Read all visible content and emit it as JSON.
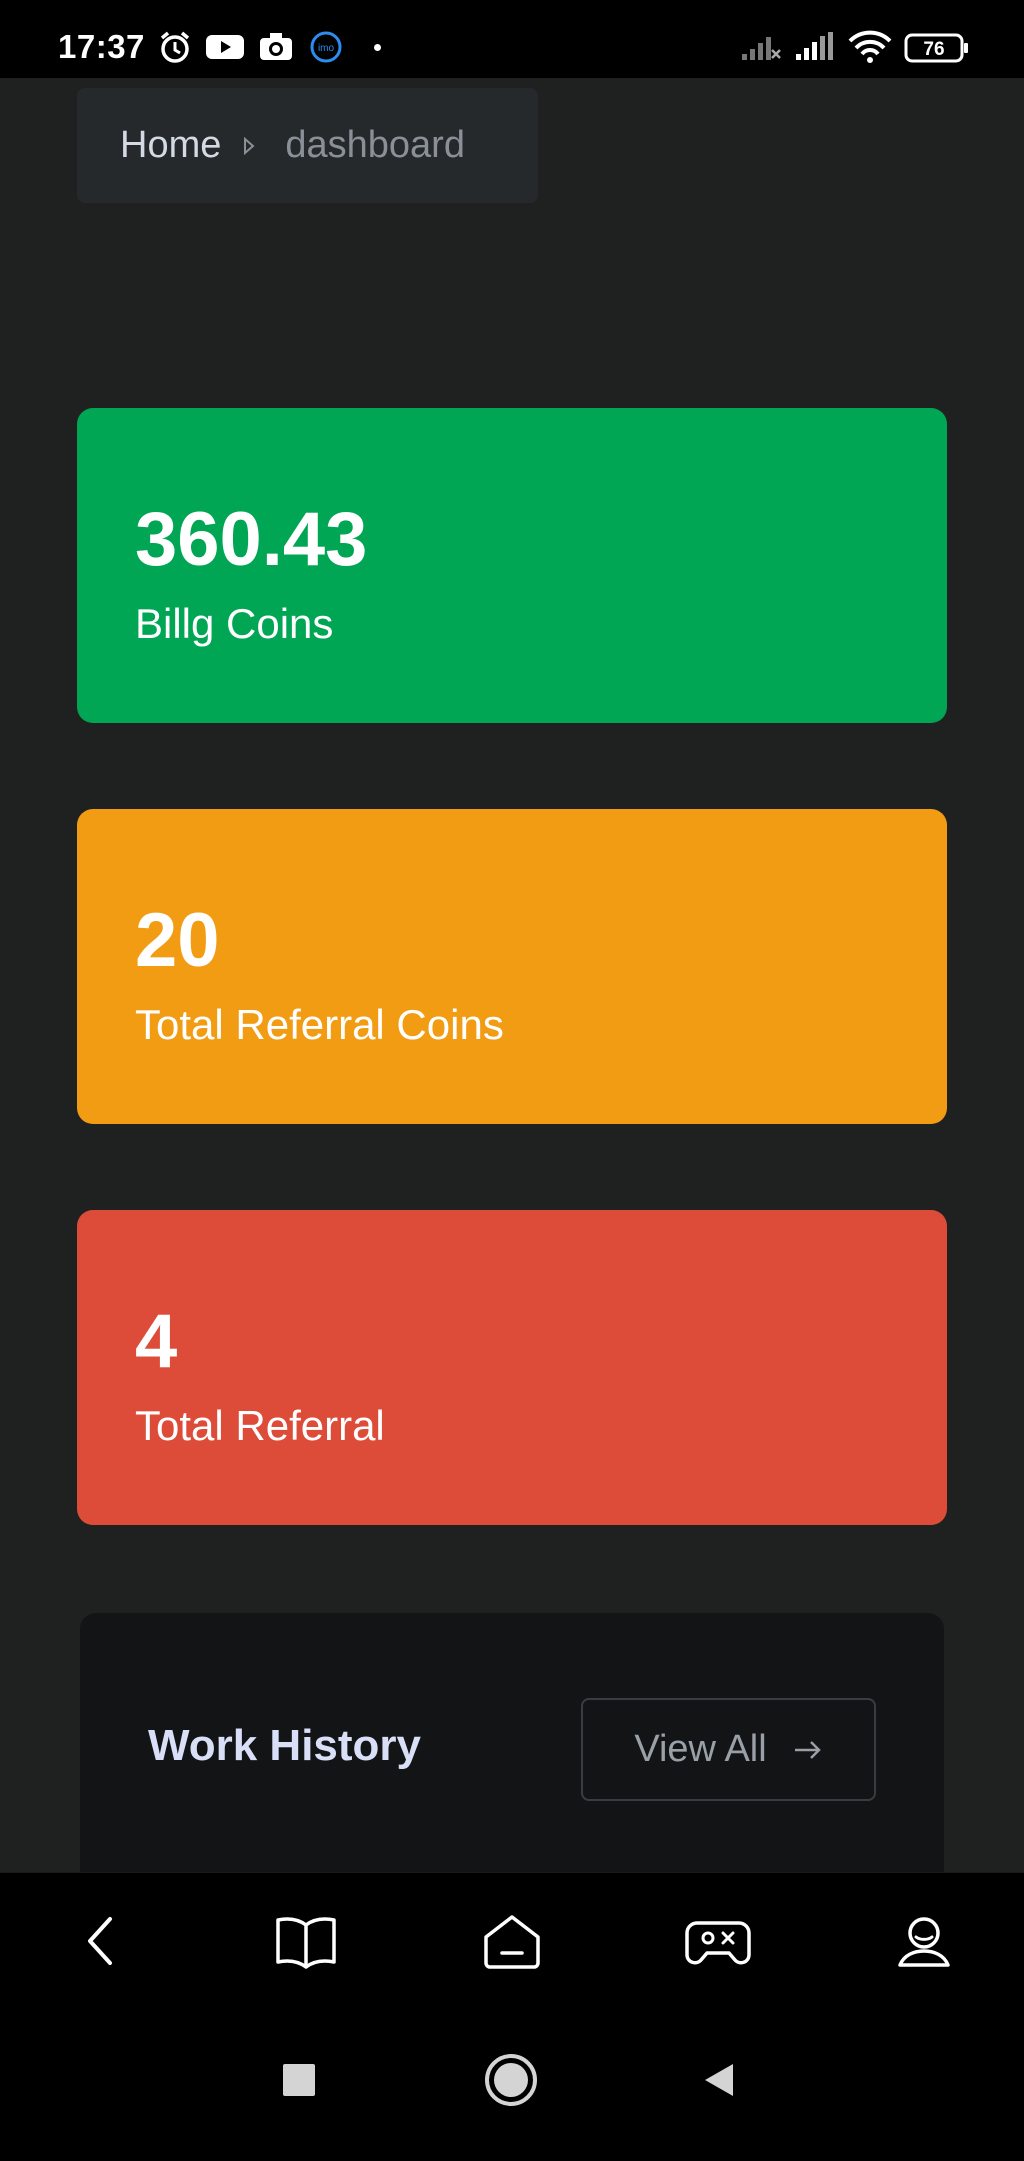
{
  "status_bar": {
    "time": "17:37",
    "battery": "76",
    "icons": [
      "alarm-icon",
      "youtube-icon",
      "camera-icon",
      "imo-icon",
      "signal-x-icon",
      "signal-icon",
      "wifi-icon",
      "battery-icon"
    ]
  },
  "breadcrumb": {
    "home": "Home",
    "current": "dashboard"
  },
  "stats": [
    {
      "value": "360.43",
      "label": "Billg Coins",
      "color": "#00a653"
    },
    {
      "value": "20",
      "label": "Total Referral Coins",
      "color": "#f29c14"
    },
    {
      "value": "4",
      "label": "Total Referral",
      "color": "#dd4c39"
    }
  ],
  "work_history": {
    "title": "Work History",
    "view_all": "View All"
  },
  "app_nav": {
    "items": [
      "back-icon",
      "book-icon",
      "home-icon",
      "gamepad-icon",
      "profile-icon"
    ]
  },
  "system_nav": {
    "items": [
      "recents-icon",
      "home-circle-icon",
      "back-triangle-icon"
    ]
  },
  "colors": {
    "background": "#1f2121",
    "panel": "#131415",
    "accent_text": "#d8dff7"
  }
}
